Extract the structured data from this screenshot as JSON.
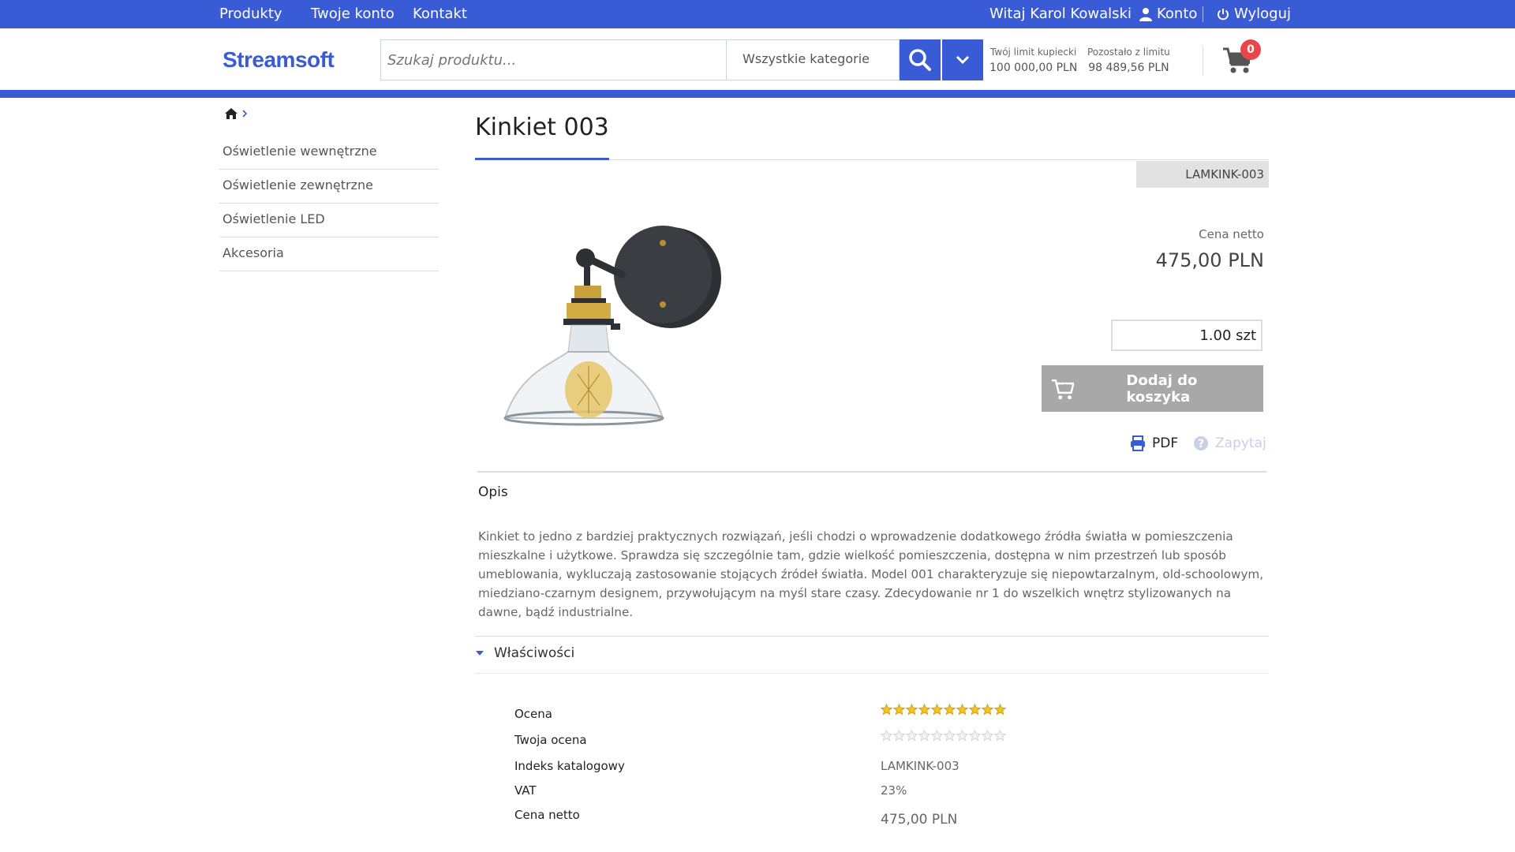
{
  "topbar": {
    "nav": [
      "Produkty",
      "Twoje konto",
      "Kontakt"
    ],
    "welcome": "Witaj Karol Kowalski",
    "account": "Konto",
    "logout": "Wyloguj"
  },
  "header": {
    "logo": "Streamsoft",
    "search_placeholder": "Szukaj produktu...",
    "category": "Wszystkie kategorie",
    "limit_label": "Twój limit kupiecki",
    "limit_value": "100 000,00 PLN",
    "remaining_label": "Pozostało z limitu",
    "remaining_value": "98 489,56 PLN",
    "cart_count": "0"
  },
  "sidebar": {
    "items": [
      "Oświetlenie wewnętrzne",
      "Oświetlenie zewnętrzne",
      "Oświetlenie LED",
      "Akcesoria"
    ]
  },
  "product": {
    "title": "Kinkiet 003",
    "sku": "LAMKINK-003",
    "price_label": "Cena netto",
    "price": "475,00 PLN",
    "quantity": "1.00 szt",
    "add_to_cart": "Dodaj do koszyka",
    "pdf": "PDF",
    "ask": "Zapytaj",
    "description_title": "Opis",
    "description": "Kinkiet to jedno z bardziej praktycznych rozwiązań, jeśli chodzi o wprowadzenie dodatkowego źródła światła w pomieszczenia mieszkalne i użytkowe. Sprawdza się szczególnie tam, gdzie wielkość pomieszczenia, dostępna w nim przestrzeń lub sposób umeblowania, wykluczają zastosowanie stojących źródeł światła. Model 001 charakteryzuje się niepowtarzalnym, old-schoolowym, miedziano-czarnym designem, przywołującym na myśl stare czasy. Zdecydowanie nr 1 do wszelkich wnętrz stylizowanych na dawne, bądź industrialne.",
    "properties_title": "Właściwości",
    "properties": {
      "rating_label": "Ocena",
      "rating_value": 10,
      "rating_max": 10,
      "your_rating_label": "Twoja ocena",
      "your_rating_value": 0,
      "catalog_index_label": "Indeks katalogowy",
      "catalog_index": "LAMKINK-003",
      "vat_label": "VAT",
      "vat": "23%",
      "net_price_label": "Cena netto",
      "net_price": "475,00 PLN"
    }
  },
  "colors": {
    "primary": "#3a5bd6",
    "badge": "#e9464b",
    "star_filled": "#f3c41f",
    "button_disabled": "#a8a8a8"
  }
}
